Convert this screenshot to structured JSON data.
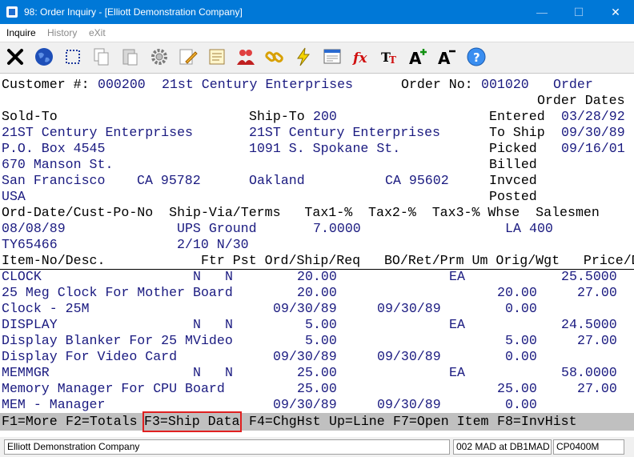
{
  "window": {
    "title": "98: Order Inquiry - [Elliott Demonstration Company]",
    "min_glyph": "—",
    "max_glyph": "☐",
    "close_glyph": "✕"
  },
  "menu": {
    "inquire": "Inquire",
    "history": "History",
    "exit": "eXit"
  },
  "toolbar": [
    {
      "name": "exit-icon"
    },
    {
      "name": "globe-icon"
    },
    {
      "name": "select-icon"
    },
    {
      "name": "copy-icon"
    },
    {
      "name": "paste-icon"
    },
    {
      "name": "settings-icon"
    },
    {
      "name": "edit-icon"
    },
    {
      "name": "notes-icon"
    },
    {
      "name": "users-icon"
    },
    {
      "name": "link-icon"
    },
    {
      "name": "lightning-icon"
    },
    {
      "name": "window-icon"
    },
    {
      "name": "fx-icon"
    },
    {
      "name": "font-icon"
    },
    {
      "name": "font-increase-icon"
    },
    {
      "name": "font-decrease-icon"
    },
    {
      "name": "help-icon"
    }
  ],
  "colors": {
    "titlebar": "#0078d7",
    "value_text": "#1a1a80",
    "fkey_bar": "#c0c0c0",
    "highlight": "#e02020"
  },
  "header": {
    "customer_label": "Customer #:",
    "customer_no": "000200",
    "customer_name": "21st Century Enterprises",
    "order_label": "Order No:",
    "order_no": "001020",
    "order_word": "Order",
    "order_dates": "Order Dates"
  },
  "sold_to": {
    "label": "Sold-To",
    "name": "21ST Century Enterprises",
    "addr1": "P.O. Box 4545",
    "addr2": "670 Manson St.",
    "city": "San Francisco",
    "state_zip": "CA 95782",
    "country": "USA"
  },
  "ship_to": {
    "label": "Ship-To",
    "code": "200",
    "name": "21ST Century Enterprises",
    "addr1": "1091 S. Spokane St.",
    "city": "Oakland",
    "state_zip": "CA 95602"
  },
  "dates": {
    "entered_label": "Entered",
    "entered": "03/28/92",
    "toship_label": "To Ship",
    "toship": "09/30/89",
    "picked_label": "Picked",
    "picked": "09/16/01",
    "billed_label": "Billed",
    "invced_label": "Invced",
    "posted_label": "Posted"
  },
  "order_info": {
    "headers": "Ord-Date/Cust-Po-No  Ship-Via/Terms   Tax1-%  Tax2-%  Tax3-% Whse  Salesmen",
    "order_date": "08/08/89",
    "ship_via": "UPS Ground",
    "tax1": "7.0000",
    "whse": "LA",
    "salesman": "400",
    "cust_po": "TY65466",
    "terms": "2/10 N/30"
  },
  "items": {
    "header": "Item-No/Desc.            Ftr Pst Ord/Ship/Req   BO/Ret/Prm Um Orig/Wgt   Price/Dis",
    "rows": [
      {
        "item": "CLOCK",
        "ftr": "N",
        "pst": "N",
        "ord": "20.00",
        "um": "EA",
        "price": "25.5000",
        "desc": "25 Meg Clock For Mother Board",
        "ship": "20.00",
        "orig": "20.00",
        "dis": "27.00",
        "desc2": "Clock - 25M",
        "req": "09/30/89",
        "prm": "09/30/89",
        "wgt": "0.00"
      },
      {
        "item": "DISPLAY",
        "ftr": "N",
        "pst": "N",
        "ord": "5.00",
        "um": "EA",
        "price": "24.5000",
        "desc": "Display Blanker For 25 MVideo",
        "ship": "5.00",
        "orig": "5.00",
        "dis": "27.00",
        "desc2": "Display For Video Card",
        "req": "09/30/89",
        "prm": "09/30/89",
        "wgt": "0.00"
      },
      {
        "item": "MEMMGR",
        "ftr": "N",
        "pst": "N",
        "ord": "25.00",
        "um": "EA",
        "price": "58.0000",
        "desc": "Memory Manager For CPU Board",
        "ship": "25.00",
        "orig": "25.00",
        "dis": "27.00",
        "desc2": "MEM - Manager",
        "req": "09/30/89",
        "prm": "09/30/89",
        "wgt": "0.00"
      }
    ]
  },
  "fkeys": {
    "f1": "F1=More",
    "f2": "F2=Totals",
    "f3": "F3=Ship Data",
    "f4": "F4=ChgHst",
    "up": "Up=Line",
    "f7": "F7=Open Item",
    "f8": "F8=InvHist"
  },
  "status": {
    "company": "Elliott Demonstration Company",
    "session": "002 MAD at DB1MAD",
    "program": "CP0400M"
  }
}
